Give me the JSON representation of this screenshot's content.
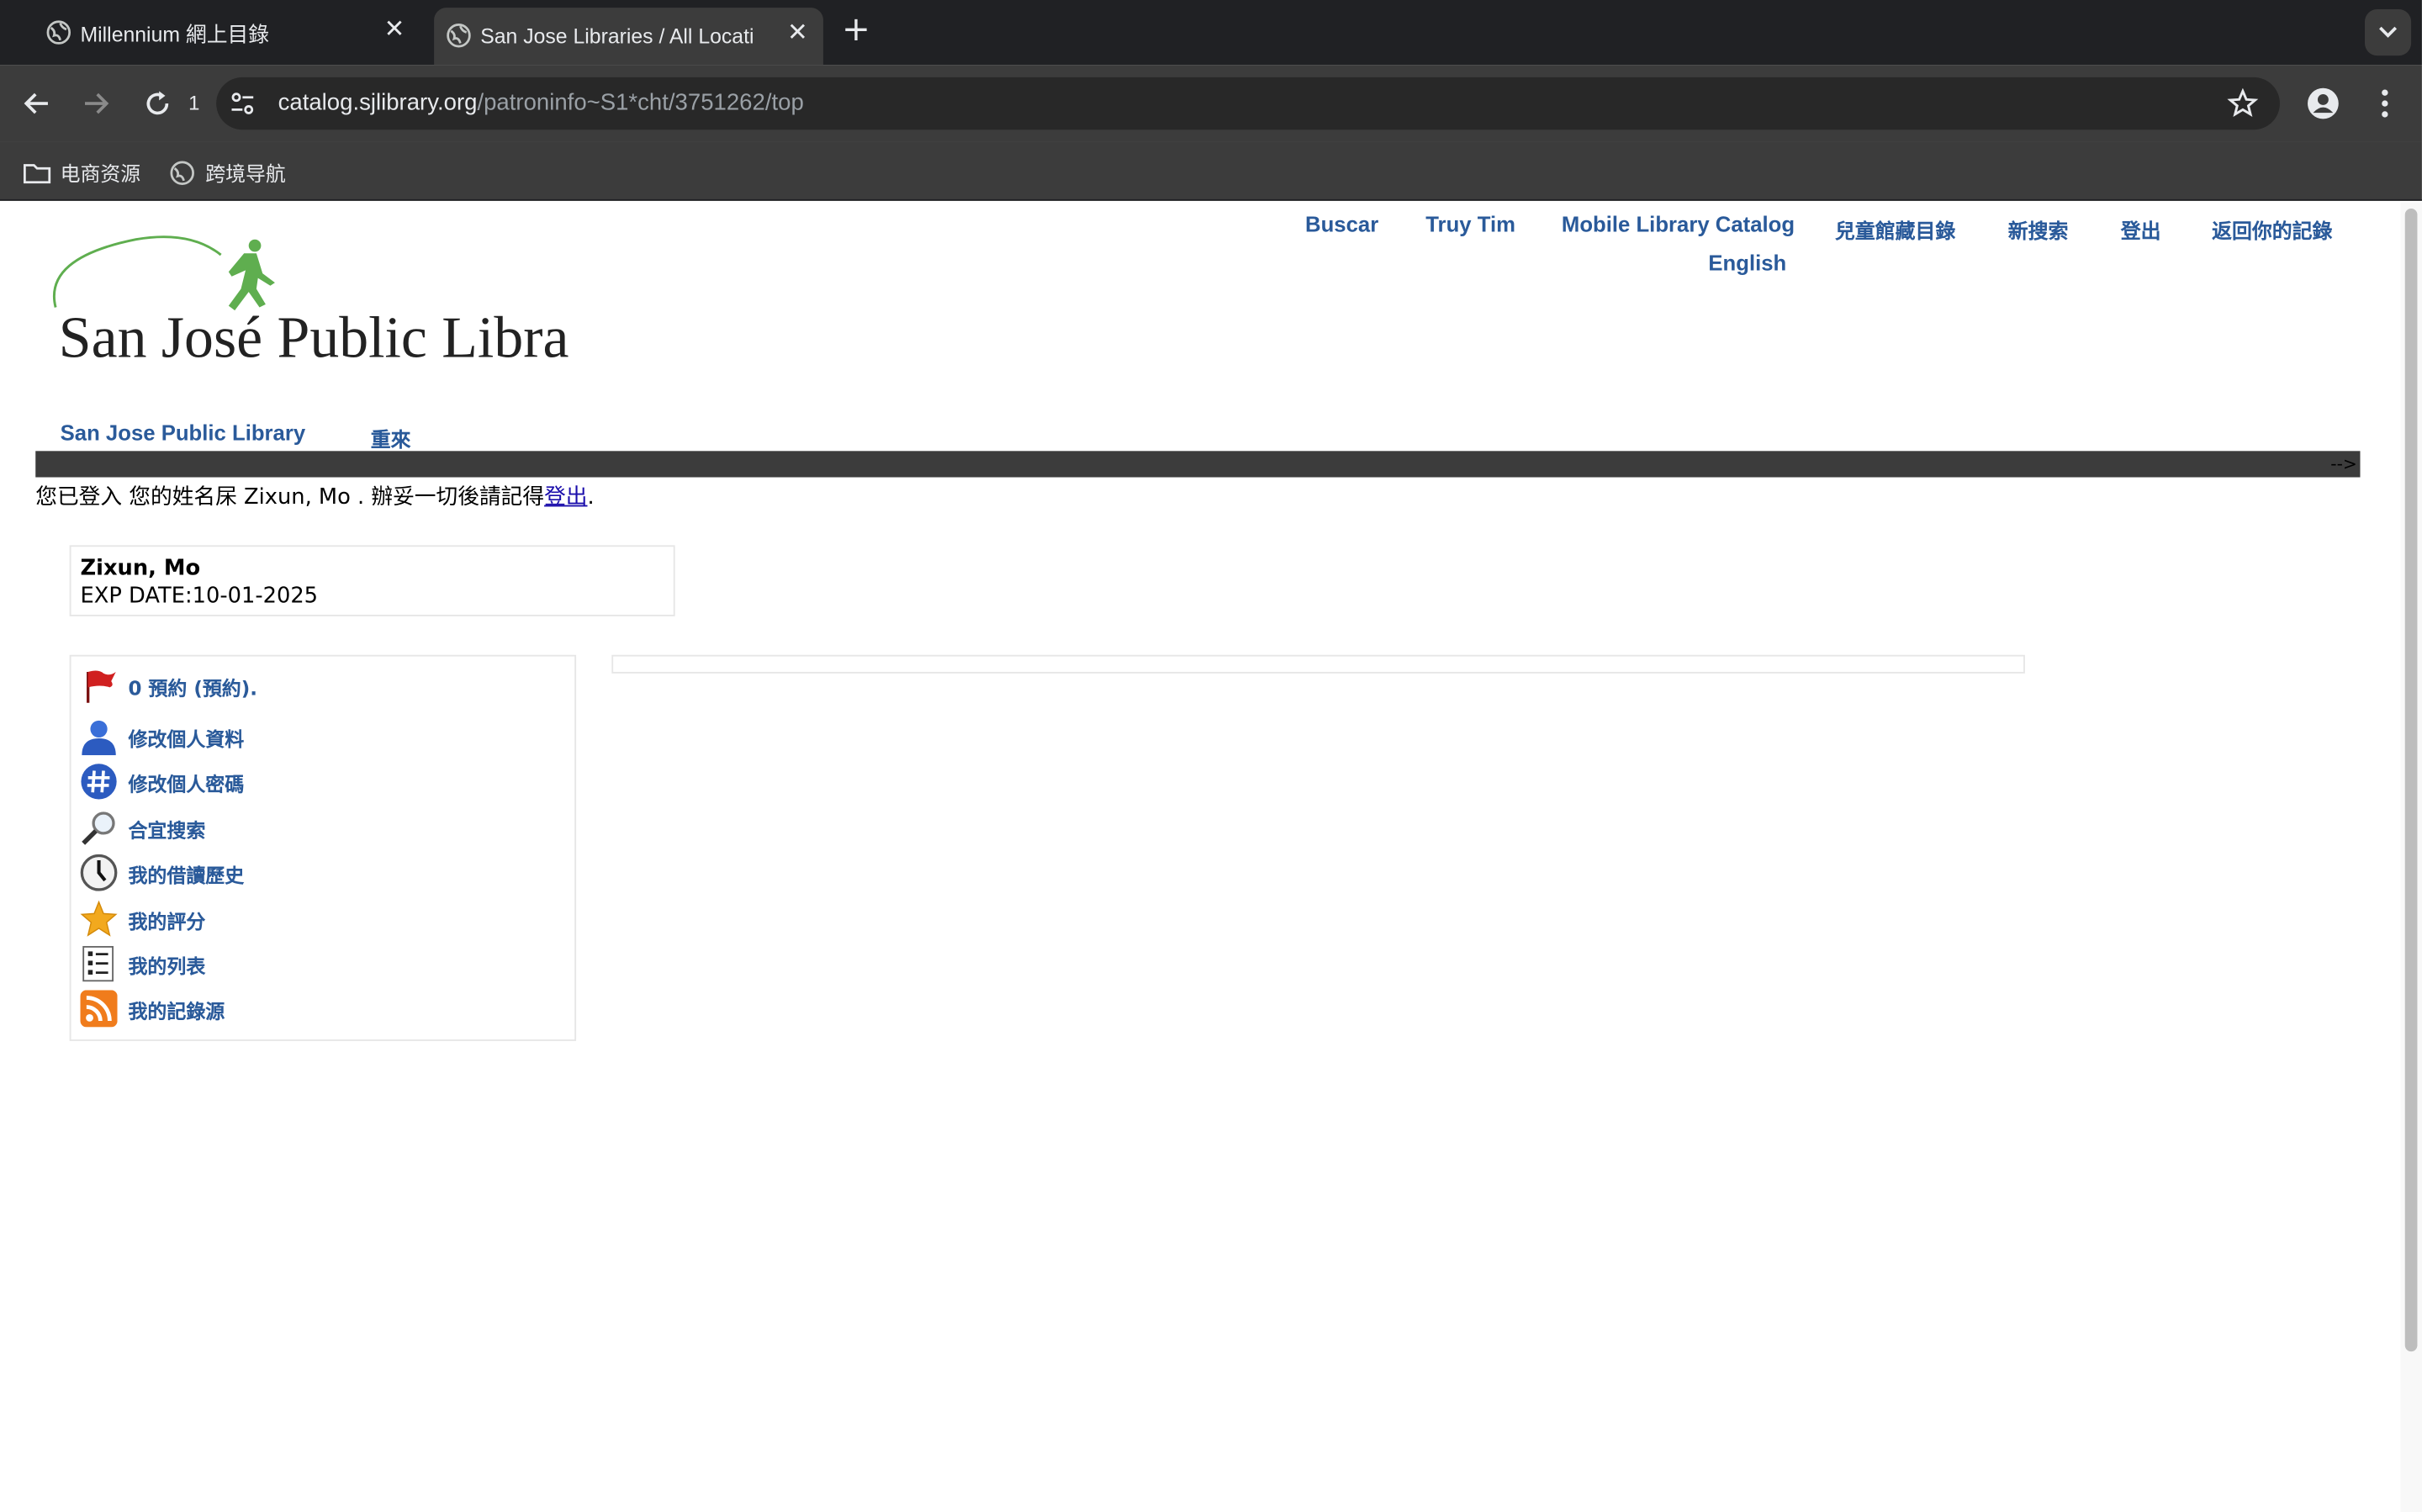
{
  "browser": {
    "tabs": [
      {
        "title": "Millennium 網上目錄",
        "active": false
      },
      {
        "title": "San Jose Libraries / All Locati",
        "active": true
      }
    ],
    "reload_count": "1",
    "url_host": "catalog.sjlibrary.org",
    "url_path": "/patroninfo~S1*cht/3751262/top",
    "bookmarks": [
      {
        "label": "电商资源",
        "icon": "folder-icon"
      },
      {
        "label": "跨境导航",
        "icon": "globe-icon"
      }
    ]
  },
  "header": {
    "logo_text": "San José Public Library",
    "top_links": {
      "buscar": "Buscar",
      "truy_tim": "Truy Tim",
      "mobile": "Mobile Library Catalog",
      "english": "English",
      "kids": "兒童館藏目錄",
      "new_search": "新搜索",
      "logout": "登出",
      "return_record": "返回你的記錄"
    }
  },
  "subnav": {
    "home": "San Jose Public Library",
    "restart": "重來"
  },
  "darkbar_text": "-->",
  "login_message": {
    "prefix": "您已登入 您的姓名杘 Zixun, Mo . 辦妥一切後請記得",
    "logout_link": "登出",
    "suffix": "."
  },
  "patron": {
    "name": "Zixun, Mo",
    "exp": "EXP DATE:10-01-2025"
  },
  "menu": {
    "items": [
      {
        "label": "0 預約 (預約).",
        "icon": "flag-icon"
      },
      {
        "label": "修改個人資料",
        "icon": "person-icon"
      },
      {
        "label": "修改個人密碼",
        "icon": "hash-icon"
      },
      {
        "label": "合宜搜索",
        "icon": "magnifier-icon"
      },
      {
        "label": "我的借讀歷史",
        "icon": "clock-icon"
      },
      {
        "label": "我的評分",
        "icon": "star-icon"
      },
      {
        "label": "我的列表",
        "icon": "list-icon"
      },
      {
        "label": "我的記錄源",
        "icon": "rss-icon"
      }
    ]
  },
  "colors": {
    "link": "#2a5a9a",
    "logo_green": "#5fae4f",
    "chrome_dark": "#202124",
    "chrome_toolbar": "#3c3c3c"
  }
}
